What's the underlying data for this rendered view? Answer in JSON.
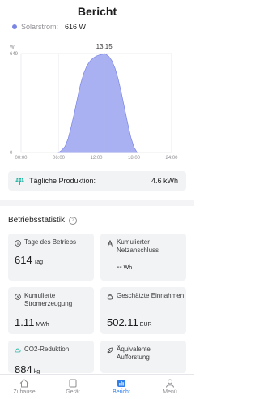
{
  "header": {
    "title": "Bericht"
  },
  "legend": {
    "label": "Solarstrom:",
    "value": "616 W",
    "color": "#7b86e4"
  },
  "chart_data": {
    "type": "area",
    "xlabel": "",
    "ylabel": "",
    "unit_label": "W",
    "x_ticks": [
      "00:00",
      "06:00",
      "12:00",
      "18:00",
      "24:00"
    ],
    "y_ticks": [
      "649",
      "0"
    ],
    "ylim": [
      0,
      649
    ],
    "xlim": [
      0,
      24
    ],
    "cursor_time": "13:15",
    "x": [
      6.0,
      6.5,
      7.0,
      7.5,
      8.0,
      8.5,
      9.0,
      9.5,
      10.0,
      10.5,
      11.0,
      11.5,
      12.0,
      12.5,
      13.0,
      13.25,
      13.5,
      14.0,
      14.5,
      15.0,
      15.5,
      16.0,
      16.5,
      17.0,
      17.5,
      18.0,
      18.5
    ],
    "values": [
      0,
      15,
      40,
      90,
      170,
      260,
      360,
      450,
      520,
      570,
      600,
      620,
      632,
      640,
      645,
      649,
      646,
      630,
      600,
      550,
      480,
      390,
      290,
      190,
      100,
      35,
      0
    ],
    "color": "#9aa3ef"
  },
  "production": {
    "label": "Tägliche Produktion:",
    "value": "4.6 kWh"
  },
  "stats": {
    "title": "Betriebsstatistik",
    "help_icon": "?",
    "cards": [
      {
        "title": "Tage des Betriebs",
        "value": "614",
        "unit": "Tag",
        "icon": "info-icon"
      },
      {
        "title": "Kumulierter Netzanschluss",
        "value": "--",
        "unit": "Wh",
        "icon": "grid-tower-icon"
      },
      {
        "title": "Kumulierte Stromerzeugung",
        "value": "1.11",
        "unit": "MWh",
        "icon": "energy-icon"
      },
      {
        "title": "Geschätzte Einnahmen",
        "value": "502.11",
        "unit": "EUR",
        "icon": "money-bag-icon"
      },
      {
        "title": "CO2-Reduktion",
        "value": "884",
        "unit": "kg",
        "icon": "co2-icon"
      },
      {
        "title": "Äquivalente Aufforstung",
        "value": "",
        "unit": "",
        "icon": "leaf-icon"
      }
    ]
  },
  "nav": {
    "items": [
      {
        "label": "Zuhause",
        "icon": "home-icon"
      },
      {
        "label": "Gerät",
        "icon": "device-icon"
      },
      {
        "label": "Bericht",
        "icon": "report-icon"
      },
      {
        "label": "Menü",
        "icon": "user-icon"
      }
    ],
    "active_color": "#2f80ed"
  }
}
